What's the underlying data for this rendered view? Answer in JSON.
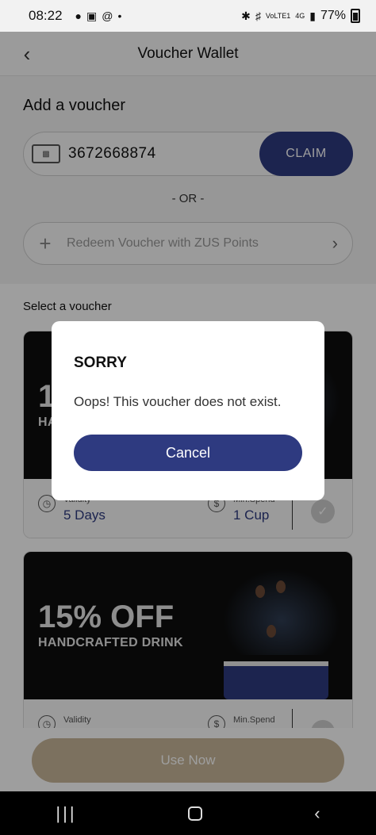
{
  "status_bar": {
    "time": "08:22",
    "battery": "77%",
    "network_label": "4G",
    "carrier_label": "VoLTE1"
  },
  "header": {
    "title": "Voucher Wallet"
  },
  "add_voucher": {
    "label": "Add a voucher",
    "code_value": "3672668874",
    "claim_label": "CLAIM",
    "or_text": "- OR -",
    "redeem_label": "Redeem Voucher with ZUS Points"
  },
  "select_label": "Select a voucher",
  "vouchers": [
    {
      "title_visible": "1",
      "subtitle_visible": "HA",
      "validity_label": "Validity",
      "validity_value": "5 Days",
      "min_spend_label": "Min.Spend",
      "min_spend_value": "1 Cup"
    },
    {
      "title": "15% OFF",
      "subtitle": "HANDCRAFTED DRINK",
      "validity_label": "Validity",
      "min_spend_label": "Min.Spend"
    }
  ],
  "use_now_label": "Use Now",
  "dialog": {
    "title": "SORRY",
    "message": "Oops! This voucher does not exist.",
    "cancel_label": "Cancel"
  },
  "colors": {
    "primary": "#2e3a80",
    "use_now_disabled": "#c9b79a"
  },
  "icons": {
    "back": "back-arrow-icon",
    "ticket": "ticket-icon",
    "plus": "plus-icon",
    "chevron": "chevron-right-icon",
    "clock": "clock-icon",
    "dollar": "dollar-icon",
    "check": "check-icon"
  }
}
